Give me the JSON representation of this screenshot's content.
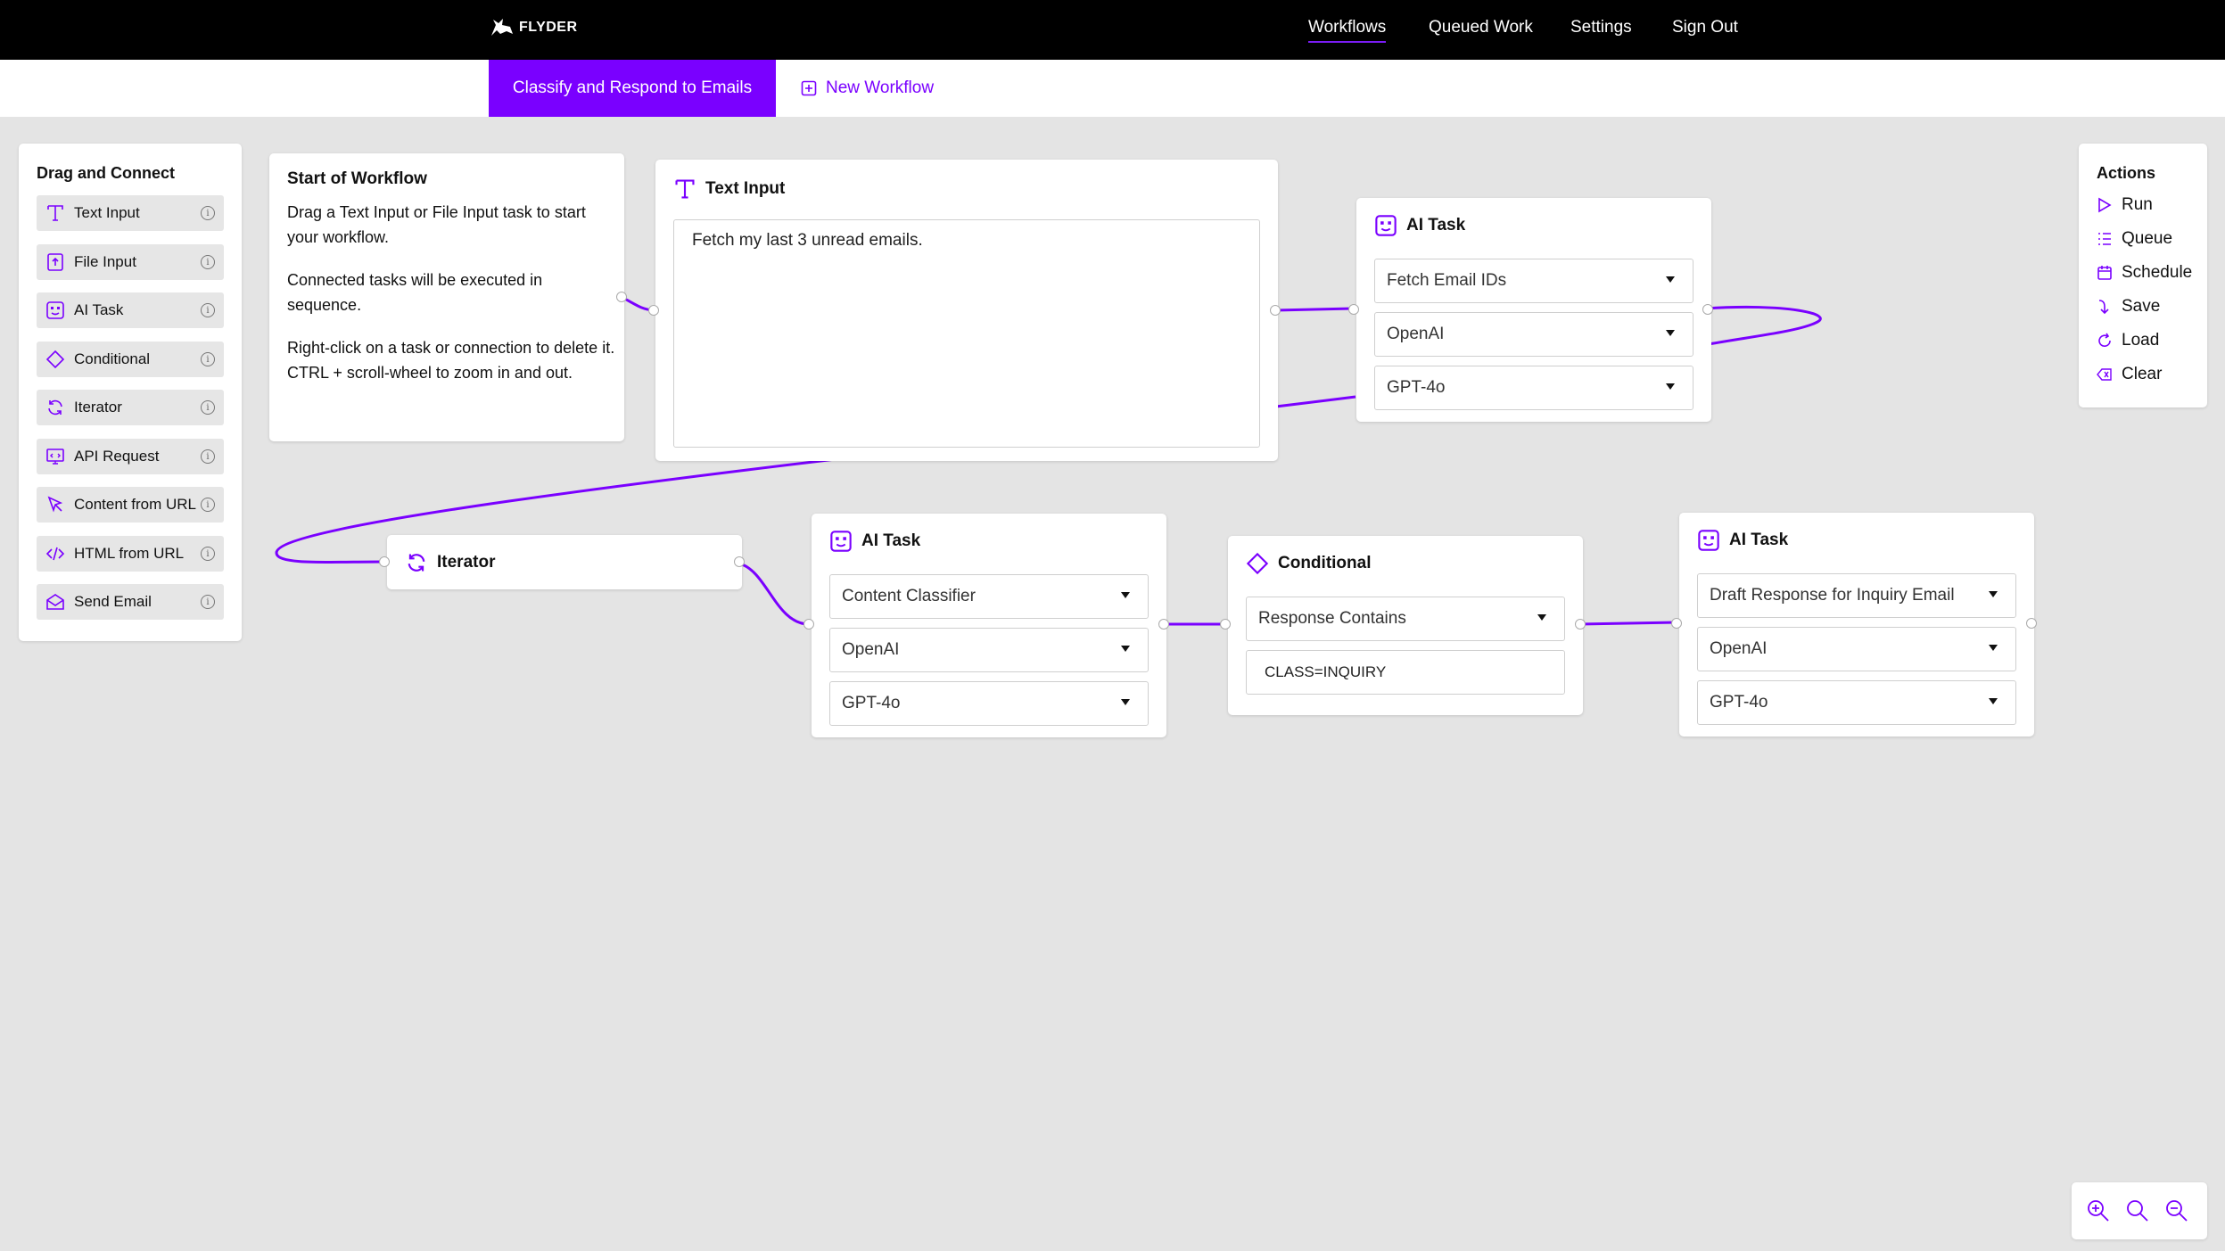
{
  "brand": {
    "name": "FLYDER"
  },
  "nav": {
    "items": [
      "Workflows",
      "Queued Work",
      "Settings",
      "Sign Out"
    ],
    "active": "Workflows"
  },
  "tabs": {
    "active_tab": "Classify and Respond to Emails",
    "new_tab": "New Workflow"
  },
  "sidebar": {
    "title": "Drag and Connect",
    "items": [
      {
        "label": "Text Input",
        "icon": "text-icon"
      },
      {
        "label": "File Input",
        "icon": "file-upload-icon"
      },
      {
        "label": "AI Task",
        "icon": "robot-icon"
      },
      {
        "label": "Conditional",
        "icon": "diamond-icon"
      },
      {
        "label": "Iterator",
        "icon": "refresh-icon"
      },
      {
        "label": "API Request",
        "icon": "api-icon"
      },
      {
        "label": "Content from URL",
        "icon": "cursor-icon"
      },
      {
        "label": "HTML from URL",
        "icon": "code-icon"
      },
      {
        "label": "Send Email",
        "icon": "mail-icon"
      }
    ]
  },
  "start_card": {
    "title": "Start of Workflow",
    "p1": "Drag a Text Input or File Input task to start your workflow.",
    "p2": "Connected tasks will be executed in sequence.",
    "p3": "Right-click on a task or connection to delete it. CTRL + scroll-wheel to zoom in and out."
  },
  "text_input_card": {
    "title": "Text Input",
    "value": "Fetch my last 3 unread emails."
  },
  "ai_task_1": {
    "title": "AI Task",
    "task": "Fetch Email IDs",
    "provider": "OpenAI",
    "model": "GPT-4o"
  },
  "iterator_card": {
    "title": "Iterator"
  },
  "ai_task_2": {
    "title": "AI Task",
    "task": "Content Classifier",
    "provider": "OpenAI",
    "model": "GPT-4o"
  },
  "conditional_card": {
    "title": "Conditional",
    "condition": "Response Contains",
    "value": "CLASS=INQUIRY"
  },
  "ai_task_3": {
    "title": "AI Task",
    "task": "Draft Response for Inquiry Email",
    "provider": "OpenAI",
    "model": "GPT-4o"
  },
  "actions": {
    "title": "Actions",
    "items": [
      "Run",
      "Queue",
      "Schedule",
      "Save",
      "Load",
      "Clear"
    ]
  },
  "colors": {
    "accent": "#7a00ff",
    "topbar": "#000000",
    "canvas": "#e4e4e4"
  }
}
